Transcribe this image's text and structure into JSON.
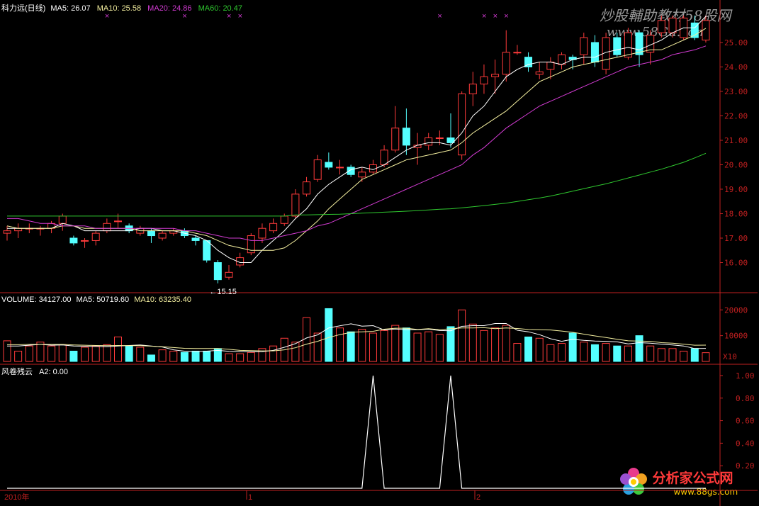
{
  "colors": {
    "up": "#ff3b3b",
    "down": "#54ffff",
    "ma5": "#ffffff",
    "ma10": "#f5f0a0",
    "ma20": "#d23bd2",
    "ma60": "#2fc82f",
    "axis": "#c02020",
    "bg": "#000000"
  },
  "header": {
    "stock": "科力远(日线)",
    "ma5": "MA5: 26.07",
    "ma10": "MA10: 25.58",
    "ma20": "MA20: 24.86",
    "ma60": "MA60: 20.47"
  },
  "watermark": {
    "top": "炒股輔助教材58股网",
    "url": "www.58Gu.com",
    "bottom": "分析家公式网",
    "bottom_url": "www.88gs.com"
  },
  "volume_header": {
    "label": "VOLUME: 34127.00",
    "ma5": "MA5: 50719.60",
    "ma10": "MA10: 63235.40"
  },
  "indicator_header": {
    "label": "风卷残云",
    "a2": "A2: 0.00"
  },
  "min_annotation": "←15.15",
  "vol_unit": "X10",
  "axis_labels": {
    "start": "2010年",
    "m1": "1",
    "m2": "2"
  },
  "chart_data": [
    {
      "type": "candlestick",
      "ylim": [
        15.0,
        26.1
      ],
      "yticks": [
        "17.00",
        "18.00",
        "19.00",
        "20.00",
        "21.00",
        "22.00",
        "23.00",
        "24.00",
        "25.00",
        "16.00"
      ],
      "ytick_values": [
        17,
        18,
        19,
        20,
        21,
        22,
        23,
        24,
        25,
        16
      ],
      "candles": [
        [
          17.2,
          17.3,
          16.9,
          17.5
        ],
        [
          17.3,
          17.4,
          17.0,
          17.6
        ],
        [
          17.4,
          17.4,
          17.2,
          17.6
        ],
        [
          17.4,
          17.4,
          17.1,
          17.5
        ],
        [
          17.4,
          17.6,
          17.2,
          17.7
        ],
        [
          17.6,
          17.9,
          17.3,
          18.0
        ],
        [
          17.0,
          16.8,
          16.7,
          17.1
        ],
        [
          16.9,
          16.9,
          16.6,
          17.0
        ],
        [
          16.9,
          17.2,
          16.7,
          17.3
        ],
        [
          17.3,
          17.6,
          17.2,
          17.8
        ],
        [
          17.7,
          17.7,
          17.4,
          18.0
        ],
        [
          17.5,
          17.3,
          17.2,
          17.6
        ],
        [
          17.2,
          17.4,
          17.1,
          17.5
        ],
        [
          17.3,
          17.1,
          16.8,
          17.4
        ],
        [
          17.0,
          17.2,
          16.9,
          17.3
        ],
        [
          17.2,
          17.3,
          17.1,
          17.4
        ],
        [
          17.3,
          17.1,
          17.0,
          17.4
        ],
        [
          17.0,
          16.9,
          16.7,
          17.1
        ],
        [
          16.9,
          16.1,
          16.0,
          16.9
        ],
        [
          16.0,
          15.3,
          15.15,
          16.1
        ],
        [
          15.4,
          15.6,
          15.3,
          15.9
        ],
        [
          15.9,
          16.2,
          15.8,
          16.4
        ],
        [
          16.4,
          17.1,
          16.3,
          17.2
        ],
        [
          17.0,
          17.4,
          16.8,
          17.6
        ],
        [
          17.3,
          17.6,
          17.2,
          17.8
        ],
        [
          17.6,
          17.9,
          17.5,
          18.0
        ],
        [
          17.9,
          18.8,
          17.8,
          19.0
        ],
        [
          18.8,
          19.3,
          18.7,
          19.5
        ],
        [
          19.4,
          20.2,
          19.3,
          20.4
        ],
        [
          20.1,
          19.9,
          19.8,
          20.5
        ],
        [
          19.9,
          19.9,
          19.6,
          20.2
        ],
        [
          19.9,
          19.6,
          19.5,
          20.0
        ],
        [
          19.5,
          19.7,
          19.3,
          19.9
        ],
        [
          19.7,
          20.0,
          19.6,
          20.2
        ],
        [
          20.0,
          20.6,
          19.9,
          20.8
        ],
        [
          20.6,
          21.5,
          20.5,
          22.4
        ],
        [
          21.5,
          20.8,
          20.4,
          22.3
        ],
        [
          20.7,
          20.8,
          20.0,
          21.3
        ],
        [
          20.8,
          21.1,
          20.6,
          21.3
        ],
        [
          21.1,
          21.1,
          20.8,
          21.4
        ],
        [
          21.1,
          20.9,
          20.7,
          22.1
        ],
        [
          20.4,
          22.9,
          20.2,
          23.0
        ],
        [
          22.9,
          23.3,
          22.4,
          23.8
        ],
        [
          23.3,
          23.6,
          22.9,
          24.1
        ],
        [
          23.6,
          23.7,
          22.9,
          24.3
        ],
        [
          23.7,
          24.6,
          23.4,
          25.5
        ],
        [
          24.6,
          24.6,
          24.5,
          24.9
        ],
        [
          24.4,
          24.0,
          23.8,
          24.6
        ],
        [
          23.7,
          23.8,
          23.5,
          24.2
        ],
        [
          23.9,
          24.2,
          23.5,
          24.4
        ],
        [
          24.1,
          24.5,
          23.9,
          24.6
        ],
        [
          24.4,
          24.3,
          23.9,
          24.5
        ],
        [
          24.5,
          25.2,
          24.1,
          25.4
        ],
        [
          25.0,
          24.2,
          24.0,
          25.3
        ],
        [
          23.9,
          25.2,
          23.7,
          25.4
        ],
        [
          25.2,
          24.5,
          24.4,
          25.4
        ],
        [
          24.4,
          25.4,
          24.3,
          25.6
        ],
        [
          25.4,
          24.5,
          24.0,
          25.5
        ],
        [
          24.6,
          25.3,
          24.1,
          25.5
        ],
        [
          25.4,
          25.9,
          25.2,
          26.1
        ],
        [
          25.4,
          26.0,
          25.2,
          26.1
        ],
        [
          25.2,
          26.0,
          25.1,
          26.1
        ],
        [
          25.8,
          25.2,
          25.1,
          26.1
        ],
        [
          25.1,
          25.9,
          25.0,
          26.1
        ]
      ],
      "series": [
        {
          "name": "MA5",
          "values": [
            17.4,
            17.4,
            17.4,
            17.4,
            17.4,
            17.6,
            17.5,
            17.3,
            17.3,
            17.3,
            17.3,
            17.3,
            17.4,
            17.4,
            17.3,
            17.3,
            17.2,
            17.1,
            16.9,
            16.5,
            16.2,
            16.0,
            16.0,
            16.5,
            16.9,
            17.3,
            17.8,
            18.2,
            18.8,
            19.2,
            19.5,
            19.8,
            19.9,
            19.8,
            20.0,
            20.3,
            20.6,
            20.8,
            20.9,
            20.9,
            20.8,
            21.3,
            22.0,
            22.4,
            23.0,
            23.6,
            23.9,
            24.1,
            24.2,
            24.2,
            24.1,
            24.3,
            24.4,
            24.4,
            24.6,
            24.7,
            24.8,
            24.7,
            24.9,
            25.1,
            25.4,
            25.6,
            25.6,
            26.07
          ]
        },
        {
          "name": "MA10",
          "values": [
            17.5,
            17.4,
            17.4,
            17.4,
            17.4,
            17.5,
            17.5,
            17.4,
            17.4,
            17.4,
            17.4,
            17.4,
            17.3,
            17.3,
            17.3,
            17.3,
            17.3,
            17.2,
            17.1,
            16.9,
            16.7,
            16.6,
            16.5,
            16.5,
            16.5,
            16.6,
            16.9,
            17.3,
            17.7,
            18.2,
            18.6,
            19.0,
            19.4,
            19.6,
            19.8,
            20.0,
            20.2,
            20.3,
            20.4,
            20.5,
            20.6,
            20.9,
            21.3,
            21.6,
            21.9,
            22.2,
            22.6,
            23.0,
            23.4,
            23.6,
            23.8,
            24.0,
            24.1,
            24.2,
            24.3,
            24.4,
            24.5,
            24.6,
            24.7,
            24.7,
            24.9,
            25.1,
            25.3,
            25.58
          ]
        },
        {
          "name": "MA20",
          "values": [
            17.8,
            17.8,
            17.7,
            17.6,
            17.6,
            17.5,
            17.5,
            17.5,
            17.4,
            17.4,
            17.4,
            17.4,
            17.4,
            17.4,
            17.4,
            17.4,
            17.3,
            17.3,
            17.2,
            17.1,
            17.0,
            17.0,
            16.9,
            16.9,
            17.0,
            17.1,
            17.2,
            17.3,
            17.5,
            17.6,
            17.8,
            18.0,
            18.2,
            18.4,
            18.6,
            18.8,
            19.0,
            19.2,
            19.4,
            19.6,
            19.8,
            20.0,
            20.4,
            20.7,
            21.1,
            21.5,
            21.8,
            22.1,
            22.4,
            22.6,
            22.8,
            23.0,
            23.2,
            23.4,
            23.6,
            23.8,
            24.0,
            24.1,
            24.2,
            24.3,
            24.5,
            24.6,
            24.7,
            24.86
          ]
        },
        {
          "name": "MA60",
          "values": [
            17.9,
            17.9,
            17.9,
            17.9,
            17.9,
            17.9,
            17.9,
            17.9,
            17.9,
            17.9,
            17.9,
            17.9,
            17.9,
            17.9,
            17.9,
            17.9,
            17.9,
            17.9,
            17.9,
            17.9,
            17.9,
            17.9,
            17.9,
            17.9,
            17.9,
            17.9,
            17.95,
            17.95,
            17.96,
            17.97,
            17.98,
            18.0,
            18.02,
            18.04,
            18.06,
            18.08,
            18.1,
            18.12,
            18.15,
            18.18,
            18.2,
            18.24,
            18.28,
            18.33,
            18.38,
            18.43,
            18.5,
            18.57,
            18.64,
            18.72,
            18.82,
            18.92,
            19.02,
            19.12,
            19.22,
            19.34,
            19.46,
            19.58,
            19.7,
            19.82,
            19.96,
            20.1,
            20.28,
            20.47
          ]
        }
      ]
    },
    {
      "type": "bar",
      "ylim": [
        0,
        22000
      ],
      "yticks": [
        "20000",
        "10000"
      ],
      "ytick_values": [
        20000,
        10000
      ],
      "values": [
        8000,
        4000,
        6000,
        7500,
        6000,
        6500,
        4000,
        5500,
        6000,
        6500,
        9500,
        6000,
        5500,
        2500,
        4500,
        4000,
        3500,
        4000,
        4000,
        5000,
        3000,
        3000,
        3500,
        5000,
        6000,
        9000,
        7500,
        17000,
        11000,
        20500,
        13000,
        11500,
        12500,
        11000,
        12000,
        14000,
        13000,
        11000,
        11500,
        10500,
        13500,
        20000,
        14500,
        12000,
        13000,
        14000,
        7000,
        9500,
        9000,
        6500,
        7000,
        11000,
        7500,
        6500,
        7000,
        6000,
        6000,
        10000,
        6000,
        5000,
        5000,
        4000,
        5000,
        3400
      ],
      "series": [
        {
          "name": "MA5",
          "values": [
            6000,
            6000,
            6300,
            6600,
            6300,
            6400,
            6000,
            5900,
            5800,
            5700,
            6000,
            6200,
            6400,
            6000,
            5600,
            4500,
            4000,
            3800,
            4000,
            4300,
            3900,
            3800,
            3700,
            3800,
            4300,
            5500,
            6900,
            9100,
            10300,
            13000,
            13800,
            14600,
            13700,
            13900,
            12200,
            12600,
            12300,
            12300,
            12500,
            12000,
            11900,
            13600,
            13900,
            13900,
            14700,
            14700,
            12100,
            11500,
            10400,
            8800,
            7800,
            8600,
            8200,
            7900,
            7800,
            7600,
            6800,
            7300,
            7100,
            6700,
            6400,
            6000,
            5000,
            5070
          ]
        },
        {
          "name": "MA10",
          "values": [
            6500,
            6500,
            6600,
            6600,
            6600,
            6600,
            6400,
            6300,
            6200,
            6100,
            6200,
            6100,
            6100,
            5900,
            5700,
            5400,
            5100,
            5000,
            5000,
            5000,
            4700,
            4300,
            4200,
            4100,
            4100,
            4500,
            5300,
            6700,
            7800,
            9300,
            10400,
            11300,
            11500,
            11700,
            12500,
            12900,
            12900,
            12400,
            12700,
            12300,
            12700,
            13000,
            13000,
            13100,
            12700,
            13000,
            12800,
            12400,
            12300,
            12200,
            11800,
            11300,
            10600,
            9900,
            9300,
            8600,
            8000,
            7900,
            7800,
            7300,
            7100,
            6700,
            6300,
            6320
          ]
        }
      ]
    },
    {
      "type": "line",
      "ylim": [
        0,
        1.05
      ],
      "yticks": [
        "1.00",
        "0.80",
        "0.60",
        "0.40",
        "0.20"
      ],
      "ytick_values": [
        1.0,
        0.8,
        0.6,
        0.4,
        0.2
      ],
      "values": [
        0,
        0,
        0,
        0,
        0,
        0,
        0,
        0,
        0,
        0,
        0,
        0,
        0,
        0,
        0,
        0,
        0,
        0,
        0,
        0,
        0,
        0,
        0,
        0,
        0,
        0,
        0,
        0,
        0,
        0,
        0,
        0,
        0,
        1,
        0,
        0,
        0,
        0,
        0,
        0,
        1,
        0,
        0,
        0,
        0,
        0,
        0,
        0,
        0,
        0,
        0,
        0,
        0,
        0,
        0,
        0,
        0,
        0,
        0,
        0,
        0,
        0,
        0,
        0
      ]
    }
  ]
}
